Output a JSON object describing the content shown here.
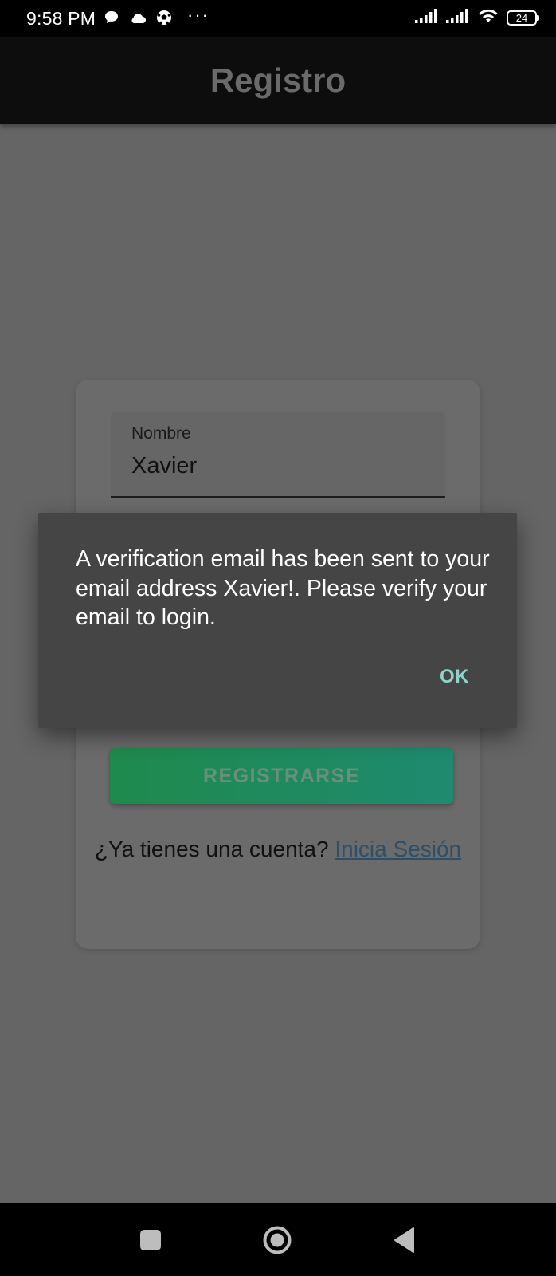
{
  "status_bar": {
    "time": "9:58 PM",
    "battery": "24",
    "dots": "···",
    "icons": [
      "chat-bubble-icon",
      "cloud-icon",
      "soccer-ball-icon",
      "signal-icon",
      "signal-icon",
      "wifi-icon",
      "battery-icon"
    ]
  },
  "app_bar": {
    "title": "Registro"
  },
  "form": {
    "name_label": "Nombre",
    "name_value": "Xavier",
    "register_button": "REGISTRARSE",
    "account_prompt": "¿Ya tienes una cuenta?",
    "login_link": "Inicia Sesión"
  },
  "dialog": {
    "message": "A verification email has been sent to your email address Xavier!. Please verify your email to login.",
    "ok_label": "OK"
  },
  "nav_bar": {
    "icons": [
      "recents-icon",
      "home-icon",
      "back-icon"
    ]
  },
  "colors": {
    "accent_green": "#1f8a4d",
    "dialog_ok": "#8fd3c9",
    "scrim": "#656565"
  }
}
